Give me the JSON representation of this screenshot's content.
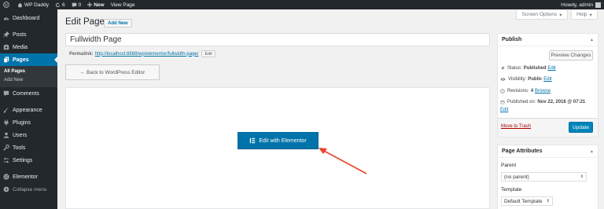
{
  "admin_bar": {
    "site_name": "WP Daddy",
    "updates_count": "6",
    "comments_count": "0",
    "new_label": "New",
    "view_page_label": "View Page",
    "howdy": "Howdy, admin"
  },
  "sidebar": {
    "items": [
      {
        "label": "Dashboard",
        "icon": "dashboard-icon"
      },
      {
        "label": "Posts",
        "icon": "pin-icon"
      },
      {
        "label": "Media",
        "icon": "media-icon"
      },
      {
        "label": "Pages",
        "icon": "pages-icon"
      },
      {
        "label": "Comments",
        "icon": "comment-icon"
      },
      {
        "label": "Appearance",
        "icon": "brush-icon"
      },
      {
        "label": "Plugins",
        "icon": "plugin-icon"
      },
      {
        "label": "Users",
        "icon": "users-icon"
      },
      {
        "label": "Tools",
        "icon": "wrench-icon"
      },
      {
        "label": "Settings",
        "icon": "settings-icon"
      },
      {
        "label": "Elementor",
        "icon": "elementor-icon"
      },
      {
        "label": "Collapse menu",
        "icon": "collapse-icon"
      }
    ],
    "submenu": [
      "All Pages",
      "Add New"
    ]
  },
  "header": {
    "screen_options": "Screen Options",
    "help": "Help",
    "title": "Edit Page",
    "add_new": "Add New"
  },
  "editor": {
    "title_value": "Fullwidth Page",
    "permalink_label": "Permalink:",
    "permalink_url": "http://localhost:8888/wp/elementor/fullwidth-page/",
    "permalink_edit": "Edit",
    "back_button": "← Back to WordPress Editor",
    "elementor_button": "Edit with Elementor"
  },
  "publish": {
    "title": "Publish",
    "preview": "Preview Changes",
    "status_label": "Status:",
    "status_value": "Published",
    "visibility_label": "Visibility:",
    "visibility_value": "Public",
    "revisions_label": "Revisions:",
    "revisions_value": "4",
    "browse": "Browse",
    "published_on_label": "Published on:",
    "published_on_value": "Nov 22, 2016 @ 07:21",
    "edit": "Edit",
    "trash": "Move to Trash",
    "update": "Update"
  },
  "page_attributes": {
    "title": "Page Attributes",
    "parent_label": "Parent",
    "parent_value": "(no parent)",
    "template_label": "Template",
    "template_value": "Default Template"
  },
  "colors": {
    "accent": "#0073aa",
    "arrow": "#e8442f"
  }
}
